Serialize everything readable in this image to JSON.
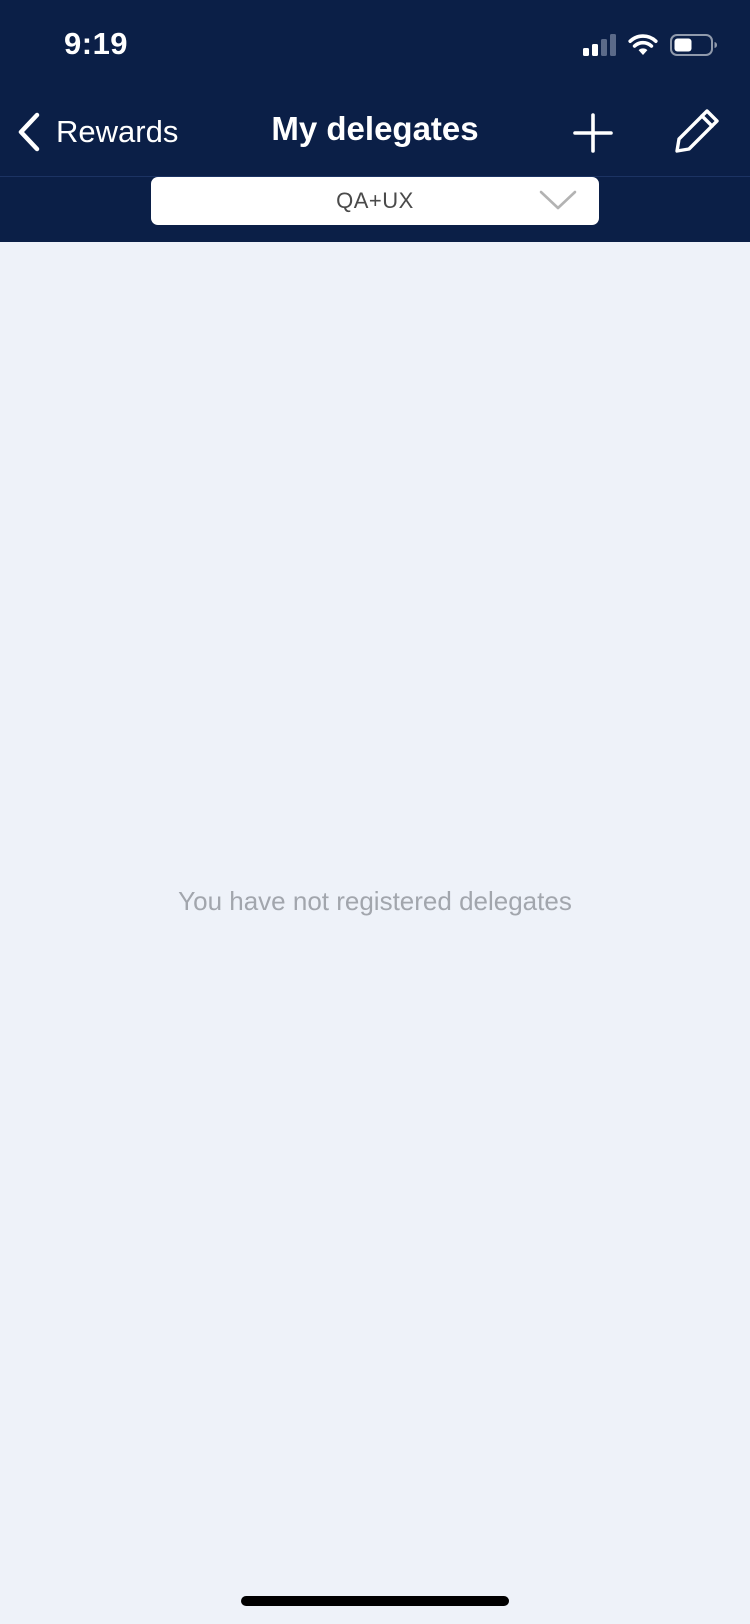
{
  "status_bar": {
    "time": "9:19",
    "icons": [
      "cellular-signal-icon",
      "wifi-icon",
      "battery-icon"
    ]
  },
  "nav": {
    "back_label": "Rewards",
    "title": "My delegates",
    "add_icon": "plus-icon",
    "edit_icon": "pencil-icon"
  },
  "filter": {
    "selected": "QA+UX",
    "icon": "chevron-down-icon"
  },
  "content": {
    "empty_message": "You have not registered delegates"
  },
  "colors": {
    "header_background": "#0b1f47",
    "page_background": "#eef2f9",
    "empty_text": "#a2a6ad"
  }
}
